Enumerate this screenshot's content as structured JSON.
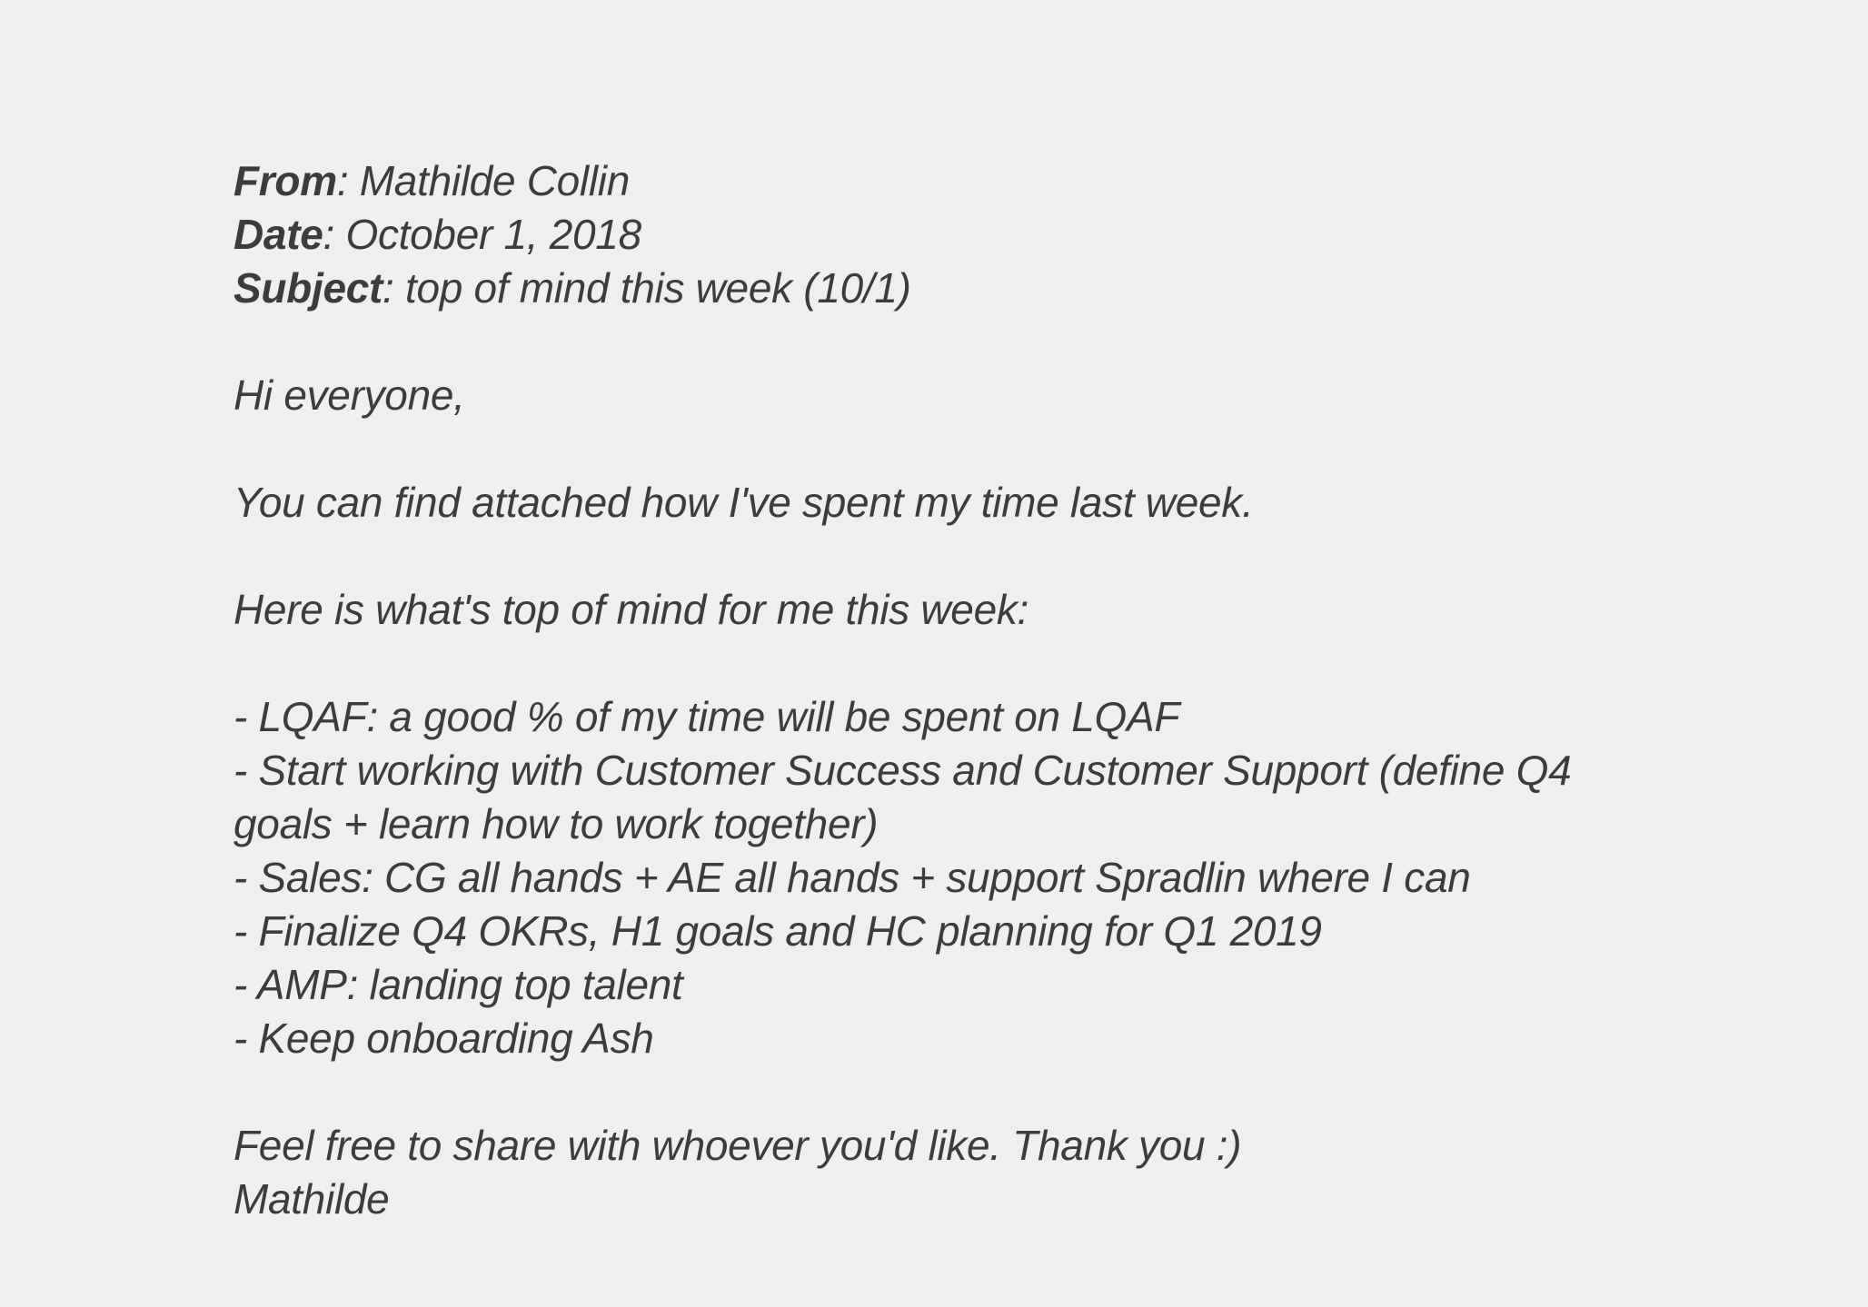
{
  "email": {
    "headers": {
      "from_label": "From",
      "from_value": "Mathilde Collin",
      "date_label": "Date",
      "date_value": "October 1, 2018",
      "subject_label": "Subject",
      "subject_value": "top of mind this week (10/1)"
    },
    "body": {
      "greeting": "Hi everyone,",
      "paragraph_1": "You can find attached how I've spent my time last week.",
      "paragraph_2": "Here is what's top of mind for me this week:",
      "items": [
        "- LQAF: a good % of my time will be spent on LQAF",
        "- Start working with Customer Success and Customer Support (define Q4 goals + learn how to work together)",
        "- Sales: CG all hands + AE all hands + support Spradlin where I can",
        "- Finalize Q4 OKRs, H1 goals and HC planning for Q1 2019",
        "- AMP: landing top talent",
        "- Keep onboarding Ash"
      ],
      "closing": "Feel free to share with whoever you'd like. Thank you :)",
      "signature": "Mathilde"
    }
  }
}
